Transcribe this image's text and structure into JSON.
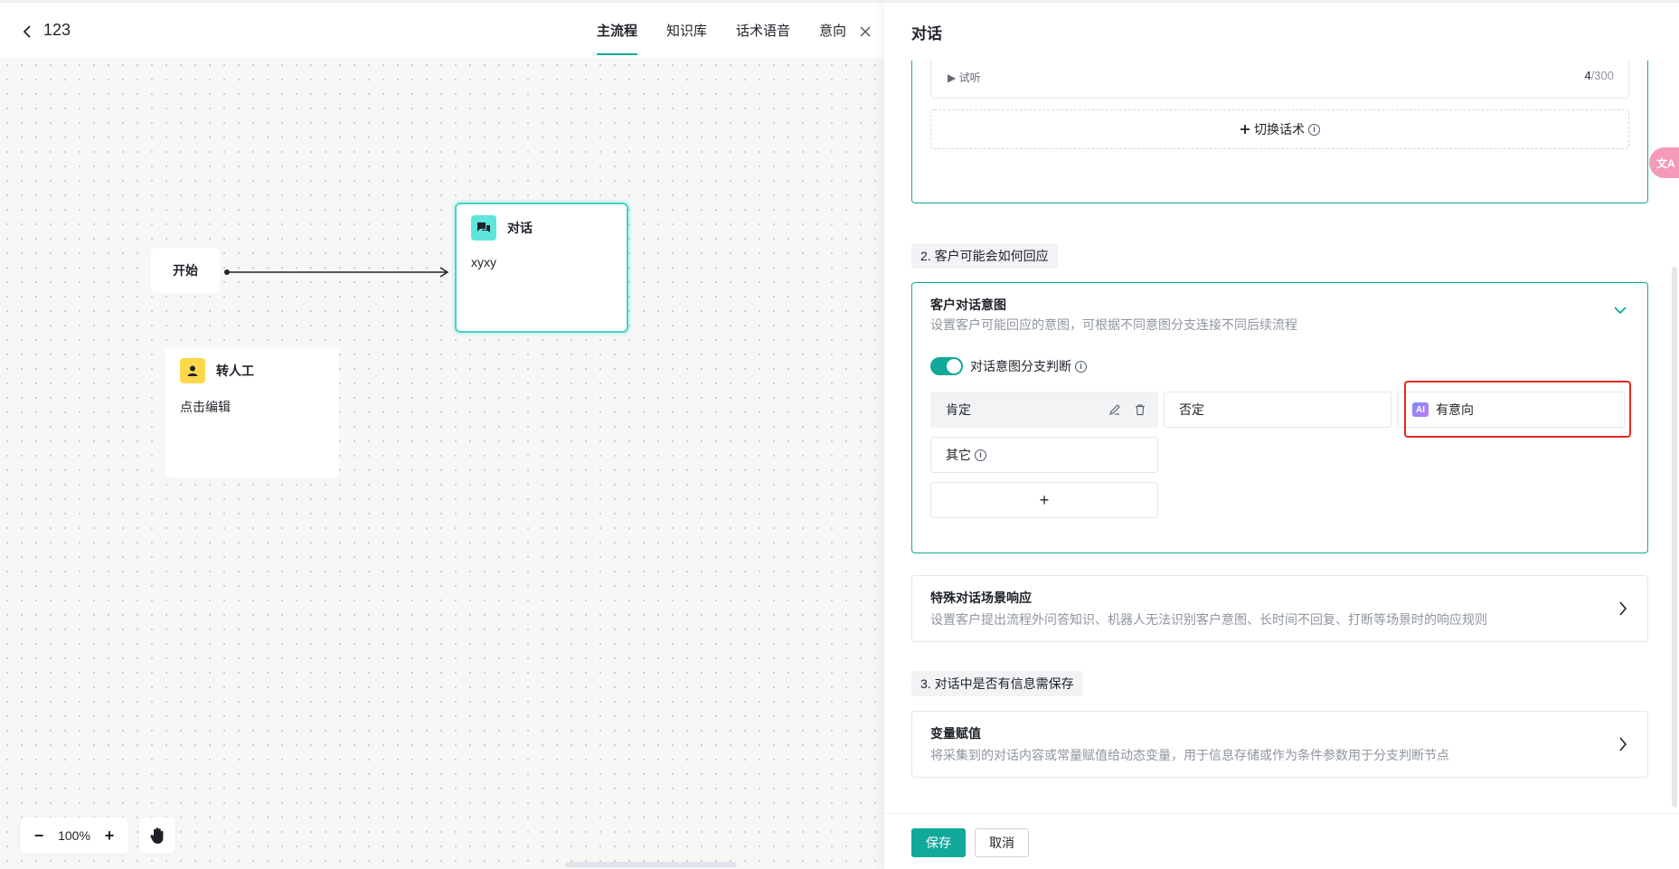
{
  "header": {
    "flow_name": "123",
    "tabs": [
      {
        "label": "主流程",
        "active": true
      },
      {
        "label": "知识库",
        "active": false
      },
      {
        "label": "话术语音",
        "active": false
      },
      {
        "label": "意向",
        "active": false
      }
    ]
  },
  "canvas": {
    "start_node": {
      "label": "开始"
    },
    "dialog_node": {
      "title": "对话",
      "body": "xyxy",
      "icon": "chat-icon",
      "icon_color": "#5ee6dc"
    },
    "human_node": {
      "title": "转人工",
      "body": "点击编辑",
      "icon": "user-icon",
      "icon_color": "#fcd94a"
    },
    "zoom": {
      "value": "100%",
      "minus": "−",
      "plus": "+"
    }
  },
  "panel": {
    "title": "对话",
    "audio": {
      "listen_label": "▶ 试听",
      "count": "4",
      "max": "/300"
    },
    "switch_script_label": "切换话术",
    "section2_label": "2. 客户可能会如何回应",
    "intent_card": {
      "title": "客户对话意图",
      "subtitle": "设置客户可能回应的意图，可根据不同意图分支连接不同后续流程",
      "toggle_label": "对话意图分支判断",
      "intents": [
        "肯定",
        "否定",
        "有意向",
        "其它"
      ],
      "ai_badge": "AI",
      "add_label": "+"
    },
    "special_card": {
      "title": "特殊对话场景响应",
      "subtitle": "设置客户提出流程外问答知识、机器人无法识别客户意图、长时间不回复、打断等场景时的响应规则"
    },
    "section3_label": "3. 对话中是否有信息需保存",
    "variable_card": {
      "title": "变量赋值",
      "subtitle": "将采集到的对话内容或常量赋值给动态变量，用于信息存储或作为条件参数用于分支判断节点"
    },
    "footer": {
      "save": "保存",
      "cancel": "取消"
    }
  },
  "colors": {
    "accent": "#11a99a",
    "highlight": "#e8261e"
  },
  "translate_fab": {
    "label": "文A"
  }
}
